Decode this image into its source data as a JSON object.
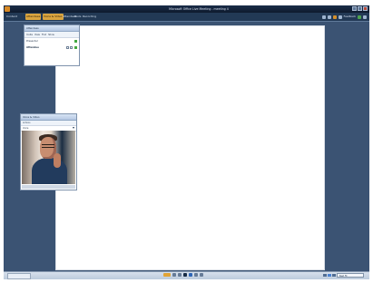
{
  "window": {
    "title": "Microsoft Office Live Meeting - meeting 4"
  },
  "menu": {
    "items": [
      "Content",
      "Attendees",
      "Voice & Video",
      "Attendees",
      "Tools",
      "Recording"
    ],
    "active_index": 1
  },
  "top_tools": {
    "label": "Feedback"
  },
  "attendees_panel": {
    "title": "Attendees",
    "tools": [
      "Invite",
      "View",
      "Find",
      "Show"
    ],
    "rows": [
      {
        "name": "Presenter"
      },
      {
        "name": "Attendee"
      }
    ]
  },
  "video_panel": {
    "title": "Voice & Video",
    "tools": "Actions",
    "selected": "Voice"
  },
  "bottombar": {
    "status_text": "",
    "zoom": "Best Fit"
  },
  "icons": {
    "app": "app-icon",
    "minimize": "minimize-icon",
    "maximize": "maximize-icon",
    "close": "close-icon",
    "status": "online-status-icon",
    "camera": "camera-icon",
    "speaker": "speaker-icon",
    "dropdown": "chevron-down-icon"
  },
  "colors": {
    "desktop": "#3b5373",
    "accent": "#d9a43f",
    "canvas": "#ffffff",
    "online": "#42a842"
  }
}
